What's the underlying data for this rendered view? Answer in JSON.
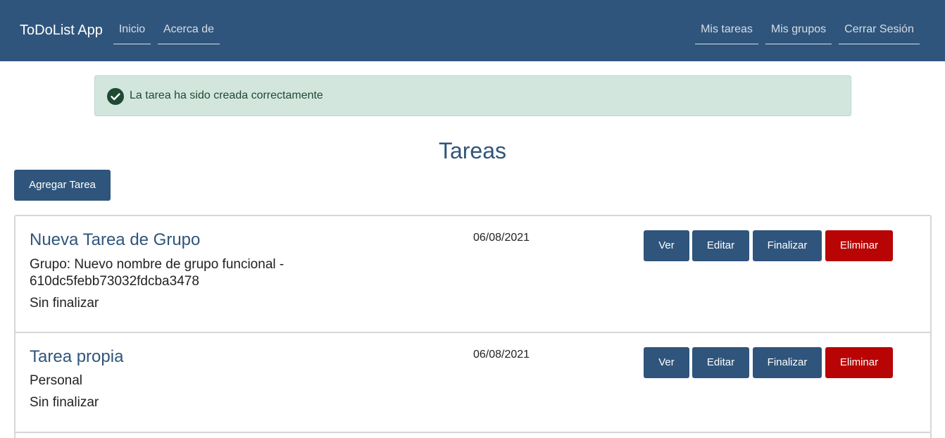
{
  "navbar": {
    "brand": "ToDoList App",
    "left_links": [
      "Inicio",
      "Acerca de"
    ],
    "right_links": [
      "Mis tareas",
      "Mis grupos",
      "Cerrar Sesión"
    ],
    "background": "#30557c"
  },
  "alert": {
    "icon": "check-circle-icon",
    "message": "La tarea ha sido creada correctamente",
    "background": "#d3e6dd"
  },
  "page": {
    "title": "Tareas",
    "add_button": "Agregar Tarea"
  },
  "tasks": [
    {
      "title": "Nueva Tarea de Grupo",
      "group": "Grupo: Nuevo nombre de grupo funcional - 610dc5febb73032fdcba3478",
      "status": "Sin finalizar",
      "date": "06/08/2021"
    },
    {
      "title": "Tarea propia",
      "group": "Personal",
      "status": "Sin finalizar",
      "date": "06/08/2021"
    }
  ],
  "task_actions": {
    "view": "Ver",
    "edit": "Editar",
    "finish": "Finalizar",
    "delete": "Eliminar",
    "delete_color": "#b80404",
    "primary_color": "#30557c"
  }
}
